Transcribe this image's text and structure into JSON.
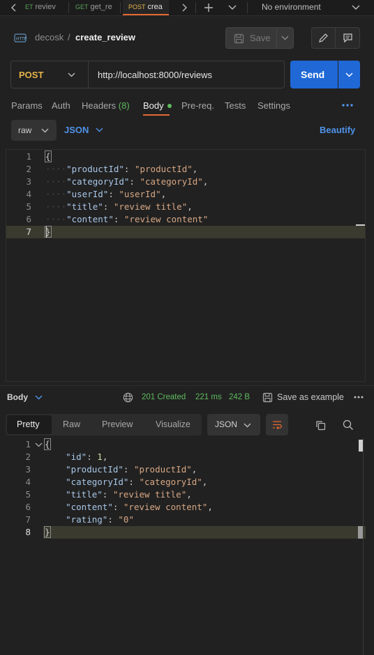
{
  "tabs": [
    {
      "method": "ET",
      "name": "reviev",
      "method_color": "#5aa35a"
    },
    {
      "method": "GET",
      "name": "get_re",
      "method_color": "#5aa35a"
    },
    {
      "method": "POST",
      "name": "crea",
      "method_color": "#e6b44a"
    }
  ],
  "environment": "No environment",
  "breadcrumb": {
    "workspace": "decosk",
    "request": "create_review"
  },
  "toolbar": {
    "save_label": "Save"
  },
  "request": {
    "method": "POST",
    "url": "http://localhost:8000/reviews",
    "send_label": "Send"
  },
  "request_tabs": {
    "params": "Params",
    "auth": "Auth",
    "headers": "Headers",
    "headers_count": "(8)",
    "body": "Body",
    "prereq": "Pre-req.",
    "tests": "Tests",
    "settings": "Settings"
  },
  "body_options": {
    "mode": "raw",
    "format": "JSON",
    "beautify": "Beautify"
  },
  "request_body": {
    "line_numbers": [
      "1",
      "2",
      "3",
      "4",
      "5",
      "6",
      "7"
    ],
    "lines": [
      [
        {
          "t": "{",
          "c": "punc"
        }
      ],
      [
        {
          "t": "\"productId\"",
          "c": "key"
        },
        {
          "t": ": ",
          "c": "punc"
        },
        {
          "t": "\"productId\"",
          "c": "str"
        },
        {
          "t": ",",
          "c": "punc"
        }
      ],
      [
        {
          "t": "\"categoryId\"",
          "c": "key"
        },
        {
          "t": ": ",
          "c": "punc"
        },
        {
          "t": "\"categoryId\"",
          "c": "str"
        },
        {
          "t": ",",
          "c": "punc"
        }
      ],
      [
        {
          "t": "\"userId\"",
          "c": "key"
        },
        {
          "t": ": ",
          "c": "punc"
        },
        {
          "t": "\"userId\"",
          "c": "str"
        },
        {
          "t": ",",
          "c": "punc"
        }
      ],
      [
        {
          "t": "\"title\"",
          "c": "key"
        },
        {
          "t": ": ",
          "c": "punc"
        },
        {
          "t": "\"review title\"",
          "c": "str"
        },
        {
          "t": ",",
          "c": "punc"
        }
      ],
      [
        {
          "t": "\"content\"",
          "c": "key"
        },
        {
          "t": ": ",
          "c": "punc"
        },
        {
          "t": "\"review content\"",
          "c": "str"
        }
      ],
      [
        {
          "t": "}",
          "c": "punc"
        }
      ]
    ]
  },
  "response_bar": {
    "label": "Body",
    "status": "201 Created",
    "time": "221 ms",
    "size": "242 B",
    "save_example": "Save as example"
  },
  "response_tabs": {
    "pretty": "Pretty",
    "raw": "Raw",
    "preview": "Preview",
    "visualize": "Visualize",
    "format": "JSON"
  },
  "response_body": {
    "line_numbers": [
      "1",
      "2",
      "3",
      "4",
      "5",
      "6",
      "7",
      "8"
    ],
    "lines": [
      [
        {
          "t": "{",
          "c": "punc"
        }
      ],
      [
        {
          "t": "\"id\"",
          "c": "key"
        },
        {
          "t": ": ",
          "c": "punc"
        },
        {
          "t": "1",
          "c": "num"
        },
        {
          "t": ",",
          "c": "punc"
        }
      ],
      [
        {
          "t": "\"productId\"",
          "c": "key"
        },
        {
          "t": ": ",
          "c": "punc"
        },
        {
          "t": "\"productId\"",
          "c": "str"
        },
        {
          "t": ",",
          "c": "punc"
        }
      ],
      [
        {
          "t": "\"categoryId\"",
          "c": "key"
        },
        {
          "t": ": ",
          "c": "punc"
        },
        {
          "t": "\"categoryId\"",
          "c": "str"
        },
        {
          "t": ",",
          "c": "punc"
        }
      ],
      [
        {
          "t": "\"title\"",
          "c": "key"
        },
        {
          "t": ": ",
          "c": "punc"
        },
        {
          "t": "\"review title\"",
          "c": "str"
        },
        {
          "t": ",",
          "c": "punc"
        }
      ],
      [
        {
          "t": "\"content\"",
          "c": "key"
        },
        {
          "t": ": ",
          "c": "punc"
        },
        {
          "t": "\"review content\"",
          "c": "str"
        },
        {
          "t": ",",
          "c": "punc"
        }
      ],
      [
        {
          "t": "\"rating\"",
          "c": "key"
        },
        {
          "t": ": ",
          "c": "punc"
        },
        {
          "t": "\"0\"",
          "c": "str"
        }
      ],
      [
        {
          "t": "}",
          "c": "punc"
        }
      ]
    ]
  },
  "colors": {
    "accent": "#e56a33",
    "send": "#1f68d6",
    "method_post": "#e6b44a",
    "status_ok": "#5fba5f",
    "link": "#4f93e8"
  }
}
